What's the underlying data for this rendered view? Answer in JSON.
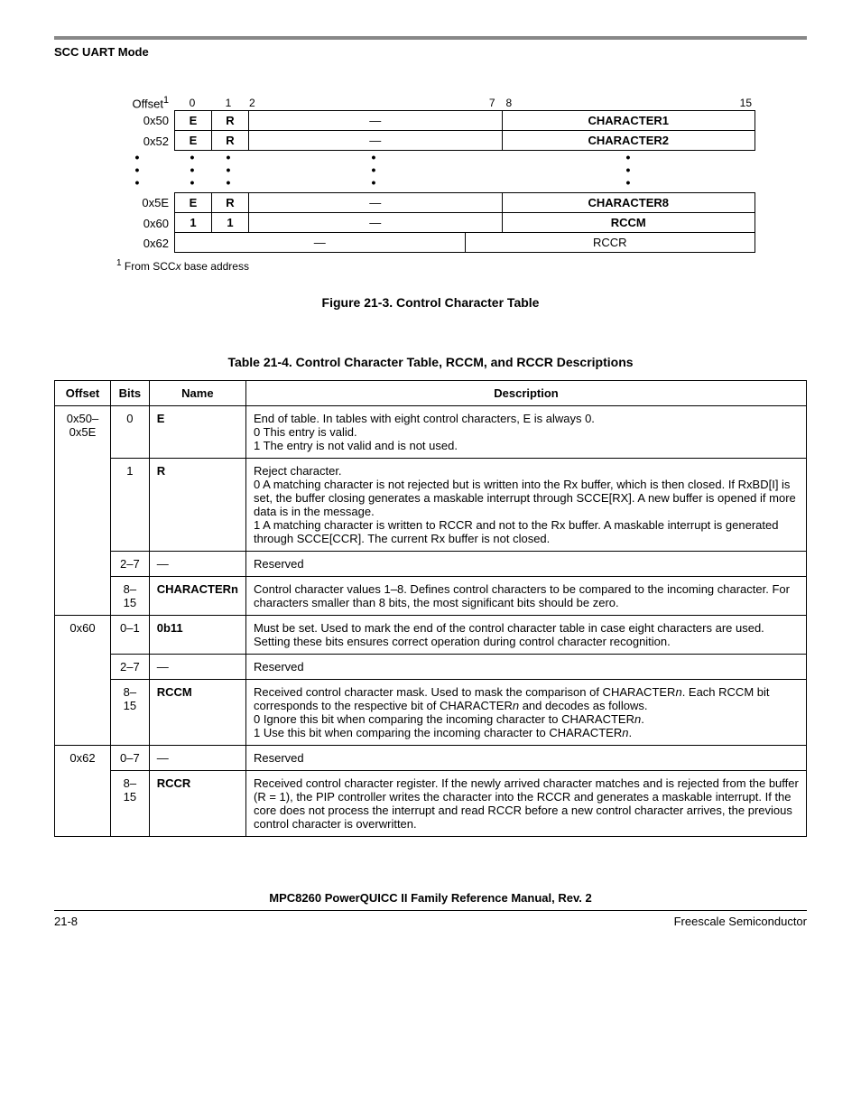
{
  "header": {
    "section": "SCC UART Mode"
  },
  "figure": {
    "offsetLabel": "Offset",
    "offsetSup": "1",
    "bits": {
      "b0": "0",
      "b1": "1",
      "b2": "2",
      "b7": "7",
      "b8": "8",
      "b15": "15"
    },
    "rows": [
      {
        "offset": "0x50",
        "e": "E",
        "r": "R",
        "dash": "—",
        "name": "CHARACTER1"
      },
      {
        "offset": "0x52",
        "e": "E",
        "r": "R",
        "dash": "—",
        "name": "CHARACTER2"
      }
    ],
    "rowsAfter": [
      {
        "offset": "0x5E",
        "e": "E",
        "r": "R",
        "dash": "—",
        "name": "CHARACTER8"
      },
      {
        "offset": "0x60",
        "e": "1",
        "r": "1",
        "dash": "—",
        "name": "RCCM"
      }
    ],
    "rowFull": {
      "offset": "0x62",
      "dash": "—",
      "name": "RCCR"
    },
    "footnotePrefix": "From SCC",
    "footnoteItalic": "x",
    "footnoteSuffix": " base address",
    "caption": "Figure 21-3. Control Character Table"
  },
  "table": {
    "caption": "Table 21-4. Control Character Table, RCCM, and RCCR Descriptions",
    "headers": {
      "offset": "Offset",
      "bits": "Bits",
      "name": "Name",
      "desc": "Description"
    },
    "rows": {
      "r1": {
        "offset": "0x50–0x5E",
        "bits": "0",
        "name": "E",
        "d1": "End of table. In tables with eight control characters, E is always 0.",
        "d2": "0  This entry is valid.",
        "d3": "1  The entry is not valid and is not used."
      },
      "r2": {
        "bits": "1",
        "name": "R",
        "d1": "Reject character.",
        "d2": "0  A matching character is not rejected but is written into the Rx buffer, which is then closed. If RxBD[I] is set, the buffer closing generates a maskable interrupt through SCCE[RX]. A new buffer is opened if more data is in the message.",
        "d3": "1  A matching character is written to RCCR and not to the Rx buffer. A maskable interrupt is generated through SCCE[CCR]. The current Rx buffer is not closed."
      },
      "r3": {
        "bits": "2–7",
        "name": "—",
        "d1": "Reserved"
      },
      "r4": {
        "bits": "8–15",
        "name": "CHARACTERn",
        "d1": "Control character values 1–8. Defines control characters to be compared to the incoming character. For characters smaller than 8 bits, the most significant bits should be zero."
      },
      "r5": {
        "offset": "0x60",
        "bits": "0–1",
        "name": "0b11",
        "d1": "Must be set. Used to mark the end of the control character table in case eight characters are used. Setting these bits ensures correct operation during control character recognition."
      },
      "r6": {
        "bits": "2–7",
        "name": "—",
        "d1": "Reserved"
      },
      "r7": {
        "bits": "8–15",
        "name": "RCCM",
        "d1a": "Received control character mask. Used to mask the comparison of CHARACTER",
        "d1b": ". Each RCCM bit corresponds to the respective bit of CHARACTER",
        "d1c": " and decodes as follows.",
        "d2a": "0  Ignore this bit when comparing the incoming character to CHARACTER",
        "d3a": "1  Use this bit when comparing the incoming character to CHARACTER",
        "n": "n",
        "dot": "."
      },
      "r8": {
        "offset": "0x62",
        "bits": "0–7",
        "name": "—",
        "d1": "Reserved"
      },
      "r9": {
        "bits": "8–15",
        "name": "RCCR",
        "d1": "Received control character register. If the newly arrived character matches and is rejected from the buffer (R = 1), the PIP controller writes the character into the RCCR and generates a maskable interrupt. If the core does not process the interrupt and read RCCR before a new control character arrives, the previous control character is overwritten."
      }
    }
  },
  "footer": {
    "manual": "MPC8260 PowerQUICC II Family Reference Manual, Rev. 2",
    "page": "21-8",
    "company": "Freescale Semiconductor"
  }
}
